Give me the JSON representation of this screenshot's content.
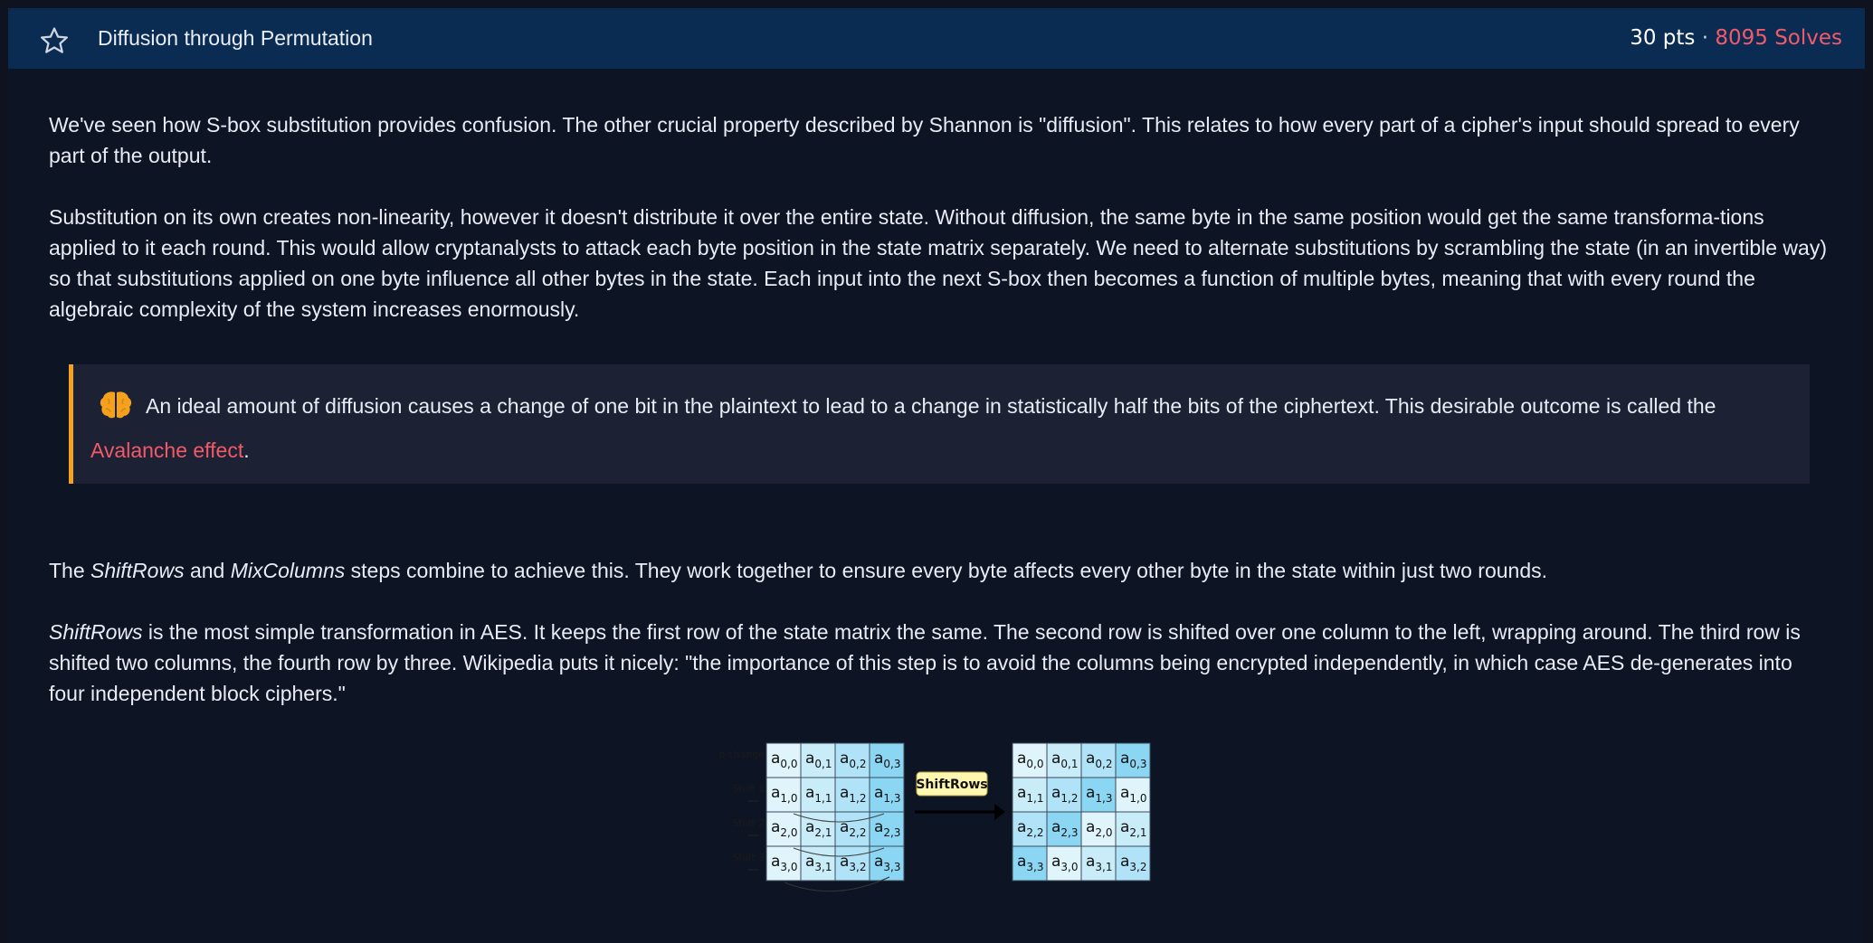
{
  "header": {
    "title": "Diffusion through Permutation",
    "points": "30 pts",
    "separator": "·",
    "solves": "8095 Solves"
  },
  "paragraphs": {
    "p1": "We've seen how S-box substitution provides confusion. The other crucial property described by Shannon is \"diffusion\". This relates to how every part of a cipher's input should spread to every part of the output.",
    "p2": "Substitution on its own creates non-linearity, however it doesn't distribute it over the entire state. Without diffusion, the same byte in the same position would get the same transforma-tions applied to it each round. This would allow cryptanalysts to attack each byte position in the state matrix separately. We need to alternate substitutions by scrambling the state (in an invertible way) so that substitutions applied on one byte influence all other bytes in the state. Each input into the next S-box then becomes a function of multiple bytes, meaning that with every round the algebraic complexity of the system increases enormously.",
    "callout_text": "An ideal amount of diffusion causes a change of one bit in the plaintext to lead to a change in statistically half the bits of the ciphertext. This desirable outcome is called the ",
    "callout_link": "Avalanche effect",
    "callout_end": ".",
    "p3_pre": "The ",
    "p3_em1": "ShiftRows",
    "p3_mid": " and ",
    "p3_em2": "MixColumns",
    "p3_post": " steps combine to achieve this. They work together to ensure every byte affects every other byte in the state within just two rounds.",
    "p4_em": "ShiftRows",
    "p4_post": " is the most simple transformation in AES. It keeps the first row of the state matrix the same. The second row is shifted over one column to the left, wrapping around. The third row is shifted two columns, the fourth row by three. Wikipedia puts it nicely: \"the importance of this step is to avoid the columns being encrypted independently, in which case AES de-generates into four independent block ciphers.\""
  },
  "diagram": {
    "arrow_label": "ShiftRows",
    "row_labels": [
      "No change",
      "Shift 1",
      "Shift 2",
      "Shift 3"
    ],
    "cell_letter": "a",
    "left_matrix": [
      [
        "0,0",
        "0,1",
        "0,2",
        "0,3"
      ],
      [
        "1,0",
        "1,1",
        "1,2",
        "1,3"
      ],
      [
        "2,0",
        "2,1",
        "2,2",
        "2,3"
      ],
      [
        "3,0",
        "3,1",
        "3,2",
        "3,3"
      ]
    ],
    "right_matrix": [
      [
        "0,0",
        "0,1",
        "0,2",
        "0,3"
      ],
      [
        "1,1",
        "1,2",
        "1,3",
        "1,0"
      ],
      [
        "2,2",
        "2,3",
        "2,0",
        "2,1"
      ],
      [
        "3,3",
        "3,0",
        "3,1",
        "3,2"
      ]
    ],
    "column_colors": [
      "#dff4fb",
      "#c9ecf9",
      "#b0e3f7",
      "#8ad6f3"
    ]
  },
  "icons": {
    "favorite": "star-outline-icon",
    "callout": "brain-icon"
  },
  "colors": {
    "accent_red": "#f25a6a",
    "callout_border": "#f4a21e",
    "header_bg": "#0b2c52"
  }
}
